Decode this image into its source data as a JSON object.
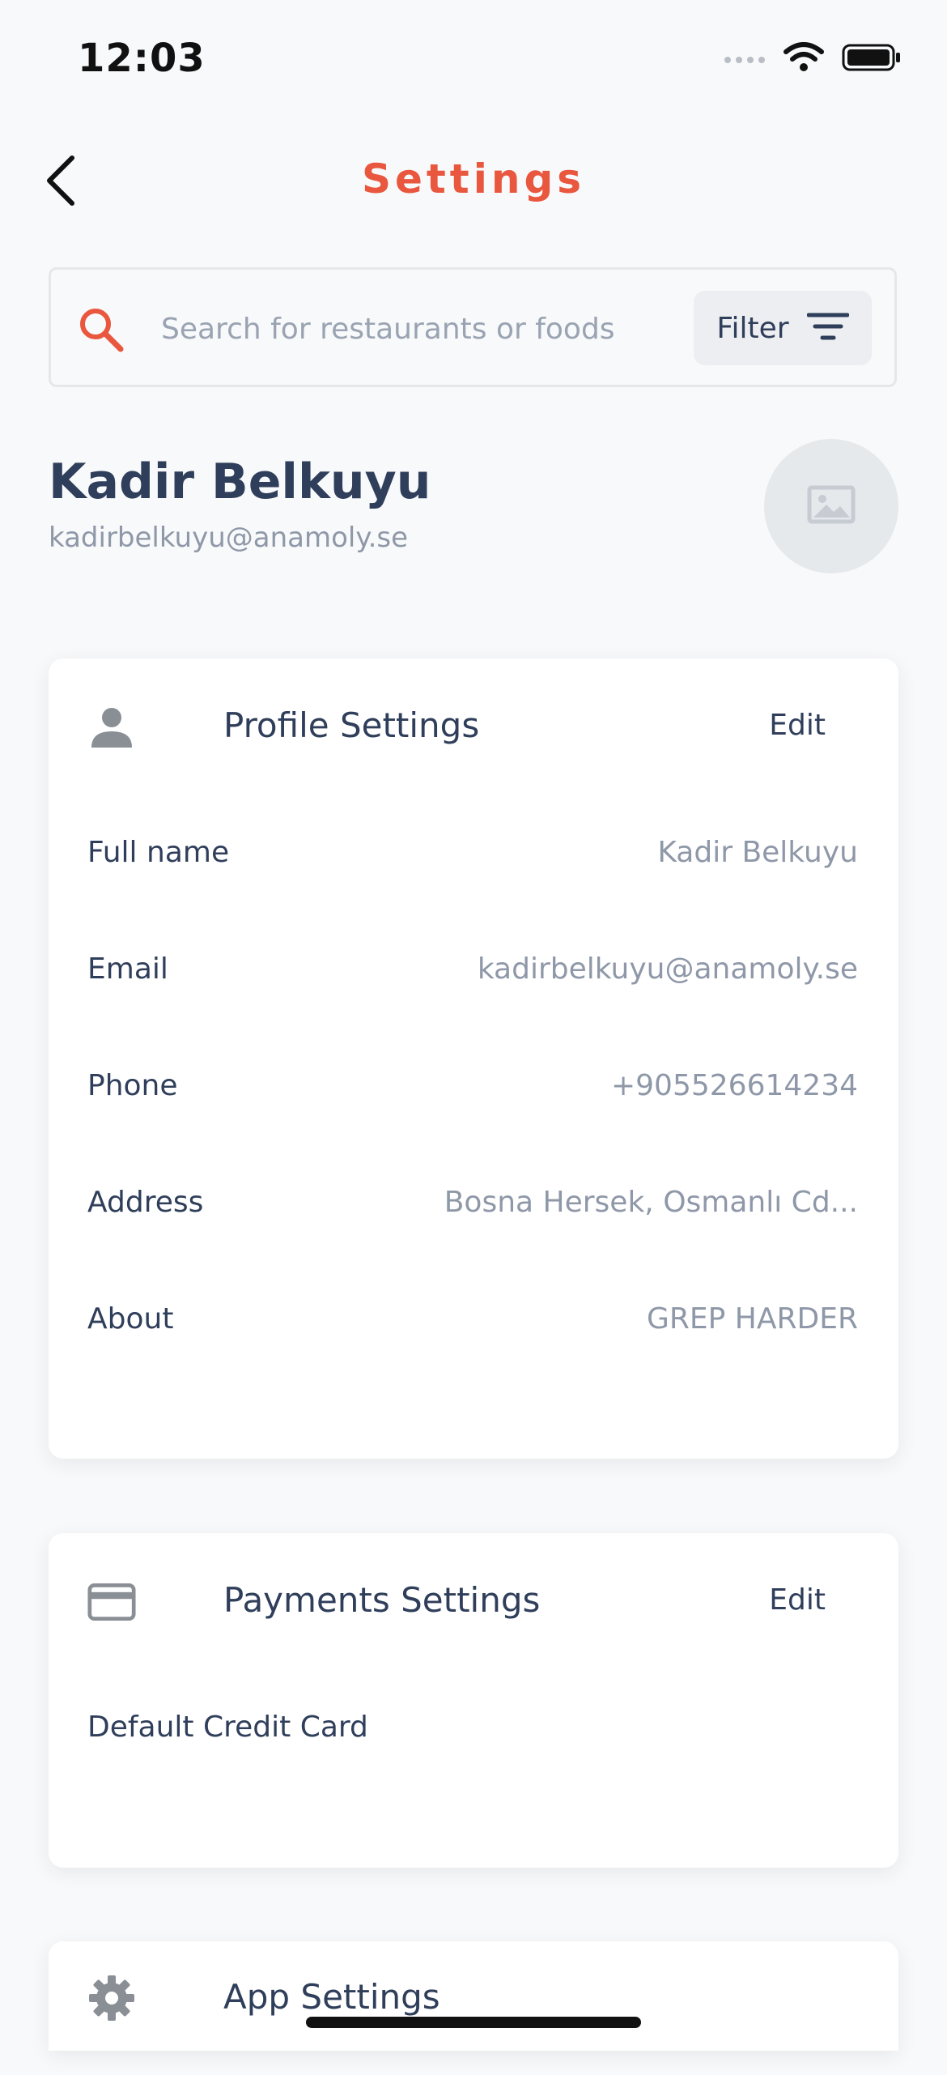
{
  "status_bar": {
    "time": "12:03"
  },
  "nav": {
    "title": "Settings",
    "back_icon": "chevron-left-icon"
  },
  "search": {
    "placeholder": "Search for restaurants or foods",
    "value": "",
    "filter_label": "Filter"
  },
  "user": {
    "name": "Kadir Belkuyu",
    "email": "kadirbelkuyu@anamoly.se",
    "avatar_icon": "image-placeholder-icon"
  },
  "profile_settings": {
    "icon": "person-icon",
    "title": "Profile Settings",
    "edit_label": "Edit",
    "fields": [
      {
        "label": "Full name",
        "value": "Kadir Belkuyu"
      },
      {
        "label": "Email",
        "value": "kadirbelkuyu@anamoly.se"
      },
      {
        "label": "Phone",
        "value": "+905526614234"
      },
      {
        "label": "Address",
        "value": "Bosna Hersek, Osmanlı Cd..."
      },
      {
        "label": "About",
        "value": "GREP HARDER"
      }
    ]
  },
  "payment_settings": {
    "icon": "credit-card-icon",
    "title": "Payments Settings",
    "edit_label": "Edit",
    "fields": [
      {
        "label": "Default Credit Card",
        "value": ""
      }
    ]
  },
  "app_settings": {
    "icon": "gear-icon",
    "title": "App Settings"
  },
  "colors": {
    "accent": "#e9573f",
    "text": "#2f3e5a",
    "muted": "#8f98a8",
    "background": "#f8f9fa"
  }
}
